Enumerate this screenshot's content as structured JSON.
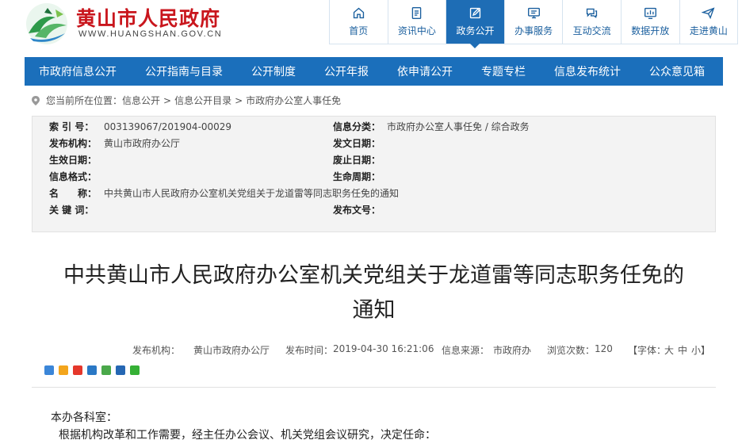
{
  "site": {
    "name": "黄山市人民政府",
    "url": "WWW.HUANGSHAN.GOV.CN"
  },
  "top_nav": [
    {
      "label": "首页",
      "icon": "home-icon"
    },
    {
      "label": "资讯中心",
      "icon": "document-icon"
    },
    {
      "label": "政务公开",
      "icon": "edit-icon",
      "active": true
    },
    {
      "label": "办事服务",
      "icon": "monitor-icon"
    },
    {
      "label": "互动交流",
      "icon": "chat-icon"
    },
    {
      "label": "数据开放",
      "icon": "chart-icon"
    },
    {
      "label": "走进黄山",
      "icon": "plane-icon"
    }
  ],
  "main_nav": [
    "市政府信息公开",
    "公开指南与目录",
    "公开制度",
    "公开年报",
    "依申请公开",
    "专题专栏",
    "信息发布统计",
    "公众意见箱"
  ],
  "breadcrumb": {
    "prefix": "您当前所在位置：",
    "items": [
      "信息公开",
      "信息公开目录",
      "市政府办公室人事任免"
    ],
    "separator": ">"
  },
  "info": {
    "index_label": "索 引 号：",
    "index_value": "003139067/201904-00029",
    "category_label": "信息分类：",
    "category_value": "市政府办公室人事任免 / 综合政务",
    "publisher_label": "发布机构：",
    "publisher_value": "黄山市政府办公厅",
    "doc_date_label": "发文日期：",
    "doc_date_value": "",
    "effective_label": "生效日期：",
    "effective_value": "",
    "abolish_label": "废止日期：",
    "abolish_value": "",
    "format_label": "信息格式：",
    "format_value": "",
    "lifecycle_label": "生命周期：",
    "lifecycle_value": "",
    "name_label": "名　　称：",
    "name_value": "中共黄山市人民政府办公室机关党组关于龙道雷等同志职务任免的通知",
    "keywords_label": "关 键 词：",
    "keywords_value": "",
    "doc_no_label": "发布文号：",
    "doc_no_value": ""
  },
  "article": {
    "title_line1": "中共黄山市人民政府办公室机关党组关于龙道雷等同志职务任免的",
    "title_line2": "通知",
    "publisher_label": "发布机构：",
    "publisher": "黄山市政府办公厅",
    "time_label": "发布时间：",
    "time": "2019-04-30 16:21:06",
    "source_label": "信息来源：",
    "source": "市政府办",
    "views_label": "浏览次数：",
    "views": "120",
    "font_open": "【字体：",
    "font_large": "大",
    "font_medium": "中",
    "font_small": "小",
    "font_close": "】",
    "body": [
      "本办各科室：",
      "根据机构改革和工作需要，经主任办公会议、机关党组会议研究，决定任命："
    ]
  },
  "share_icons": [
    {
      "name": "qzone-share-icon",
      "color": "#3b86d8"
    },
    {
      "name": "favorite-share-icon",
      "color": "#f3a51c"
    },
    {
      "name": "weibo-share-icon",
      "color": "#e5372b"
    },
    {
      "name": "renren-share-icon",
      "color": "#2a78c5"
    },
    {
      "name": "douban-share-icon",
      "color": "#4aa84a"
    },
    {
      "name": "people-share-icon",
      "color": "#2567b3"
    },
    {
      "name": "wechat-share-icon",
      "color": "#35b035"
    }
  ],
  "colors": {
    "brand_red": "#c9161d",
    "nav_blue": "#1b6fbb"
  }
}
